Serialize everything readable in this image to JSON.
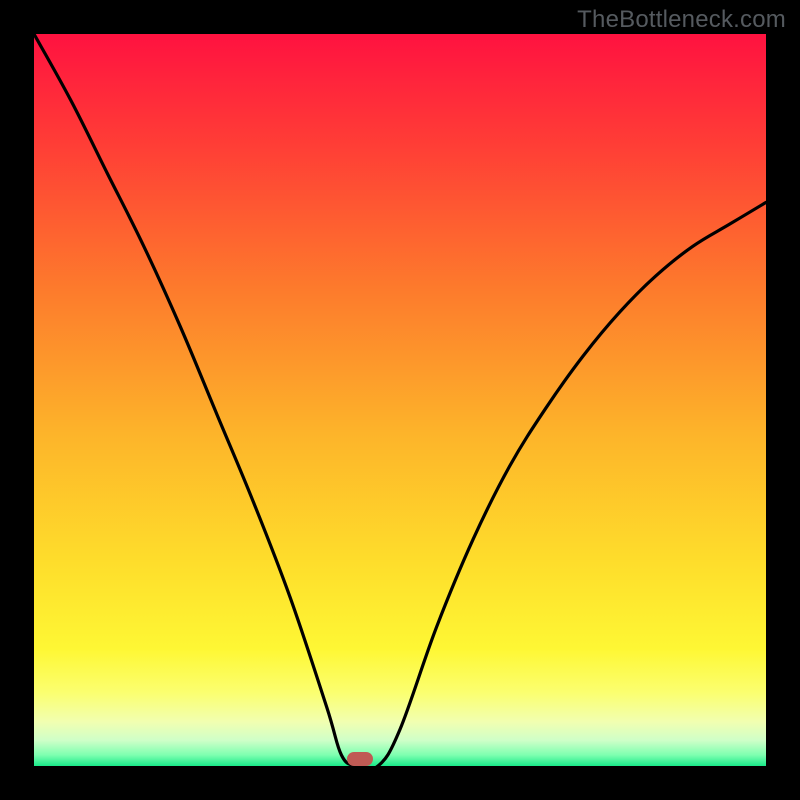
{
  "watermark": {
    "text": "TheBottleneck.com"
  },
  "colors": {
    "bg_black": "#000000",
    "watermark": "#555a5f",
    "curve": "#000000",
    "marker": "#c05a54",
    "gradient_stops": [
      {
        "offset": 0.0,
        "color": "#ff1240"
      },
      {
        "offset": 0.15,
        "color": "#ff3d36"
      },
      {
        "offset": 0.35,
        "color": "#fd7b2c"
      },
      {
        "offset": 0.55,
        "color": "#fdb52a"
      },
      {
        "offset": 0.72,
        "color": "#fedd2b"
      },
      {
        "offset": 0.84,
        "color": "#fef734"
      },
      {
        "offset": 0.9,
        "color": "#fbff70"
      },
      {
        "offset": 0.94,
        "color": "#f1ffb1"
      },
      {
        "offset": 0.965,
        "color": "#cfffc8"
      },
      {
        "offset": 0.985,
        "color": "#7effb0"
      },
      {
        "offset": 1.0,
        "color": "#19e989"
      }
    ]
  },
  "chart_data": {
    "type": "line",
    "title": "",
    "xlabel": "",
    "ylabel": "",
    "xlim": [
      0,
      1
    ],
    "ylim": [
      0,
      1
    ],
    "note": "Axis numeric labels are not displayed in the source; x and y are normalized 0–1. The curve minimum (y≈0) occurs near x≈0.44; a small rounded marker sits at that minimum.",
    "series": [
      {
        "name": "bottleneck-curve",
        "x": [
          0.0,
          0.05,
          0.1,
          0.15,
          0.2,
          0.25,
          0.3,
          0.35,
          0.4,
          0.42,
          0.44,
          0.47,
          0.5,
          0.55,
          0.6,
          0.65,
          0.7,
          0.75,
          0.8,
          0.85,
          0.9,
          0.95,
          1.0
        ],
        "y": [
          1.0,
          0.91,
          0.81,
          0.71,
          0.6,
          0.48,
          0.36,
          0.23,
          0.08,
          0.015,
          0.0,
          0.0,
          0.05,
          0.19,
          0.31,
          0.41,
          0.49,
          0.56,
          0.62,
          0.67,
          0.71,
          0.74,
          0.77
        ]
      }
    ],
    "marker": {
      "x": 0.445,
      "y": 0.01
    }
  }
}
